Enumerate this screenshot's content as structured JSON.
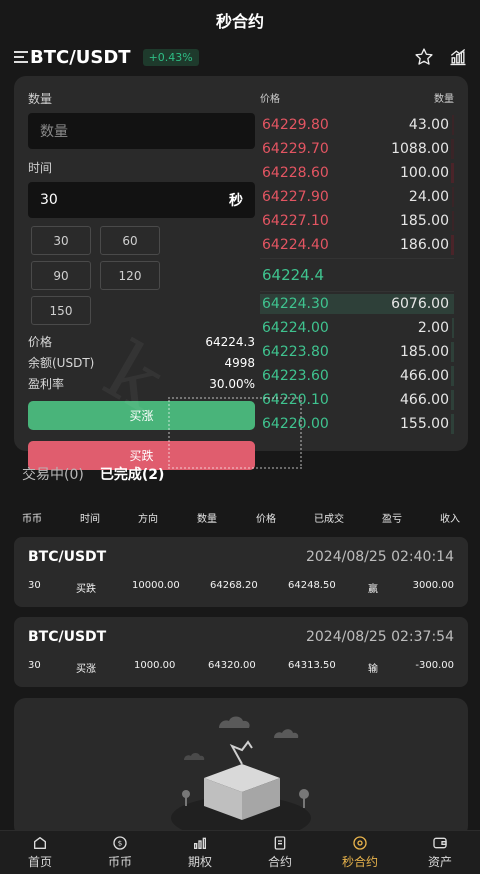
{
  "page": {
    "title": "秒合约"
  },
  "pair": {
    "symbol": "BTC/USDT",
    "change": "+0.43%"
  },
  "form": {
    "qty_label": "数量",
    "qty_placeholder": "数量",
    "time_label": "时间",
    "time_value": "30",
    "time_unit": "秒",
    "time_options": [
      "30",
      "60",
      "90",
      "120",
      "150"
    ],
    "price_label": "价格",
    "price_value": "64224.3",
    "balance_label": "余额(USDT)",
    "balance_value": "4998",
    "profit_label": "盈利率",
    "profit_value": "30.00%",
    "buy_up": "买涨",
    "buy_down": "买跌"
  },
  "orderbook": {
    "price_header": "价格",
    "qty_header": "数量",
    "asks": [
      {
        "price": "64229.80",
        "qty": "43.00"
      },
      {
        "price": "64229.70",
        "qty": "1088.00"
      },
      {
        "price": "64228.60",
        "qty": "100.00"
      },
      {
        "price": "64227.90",
        "qty": "24.00"
      },
      {
        "price": "64227.10",
        "qty": "185.00"
      },
      {
        "price": "64224.40",
        "qty": "186.00"
      }
    ],
    "last_price": "64224.4",
    "bids": [
      {
        "price": "64224.30",
        "qty": "6076.00"
      },
      {
        "price": "64224.00",
        "qty": "2.00"
      },
      {
        "price": "64223.80",
        "qty": "185.00"
      },
      {
        "price": "64223.60",
        "qty": "466.00"
      },
      {
        "price": "64220.10",
        "qty": "466.00"
      },
      {
        "price": "64220.00",
        "qty": "155.00"
      }
    ]
  },
  "tabs": {
    "trading": "交易中(0)",
    "completed": "已完成(2)"
  },
  "columns": [
    "币币",
    "时间",
    "方向",
    "数量",
    "价格",
    "已成交",
    "盈亏",
    "收入"
  ],
  "orders": [
    {
      "symbol": "BTC/USDT",
      "datetime": "2024/08/25 02:40:14",
      "time": "30",
      "direction": "买跌",
      "amount": "10000.00",
      "price": "64268.20",
      "filled": "64248.50",
      "result": "赢",
      "income": "3000.00"
    },
    {
      "symbol": "BTC/USDT",
      "datetime": "2024/08/25 02:37:54",
      "time": "30",
      "direction": "买涨",
      "amount": "1000.00",
      "price": "64320.00",
      "filled": "64313.50",
      "result": "输",
      "income": "-300.00"
    }
  ],
  "nav": [
    "首页",
    "币币",
    "期权",
    "合约",
    "秒合约",
    "资产"
  ],
  "colors": {
    "up": "#3fc38f",
    "down": "#e35562",
    "active_nav": "#e9b44c"
  }
}
